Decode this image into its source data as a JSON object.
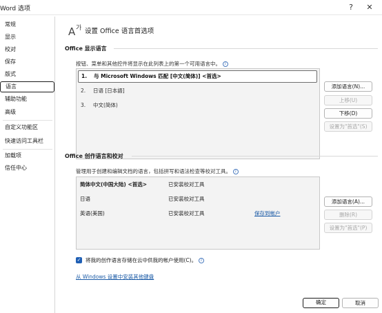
{
  "window": {
    "title": "Word 选项",
    "help_label": "?",
    "close_label": "✕"
  },
  "sidebar": {
    "items": [
      {
        "label": "常规"
      },
      {
        "label": "显示"
      },
      {
        "label": "校对"
      },
      {
        "label": "保存"
      },
      {
        "label": "版式"
      },
      {
        "label": "语言"
      },
      {
        "label": "辅助功能"
      },
      {
        "label": "高级"
      },
      {
        "label": "自定义功能区"
      },
      {
        "label": "快速访问工具栏"
      },
      {
        "label": "加载项"
      },
      {
        "label": "信任中心"
      }
    ],
    "active_index": 5
  },
  "header": {
    "title": "设置 Office 语言首选项",
    "icon": "language-icon"
  },
  "display_section": {
    "title": "Office 显示语言",
    "description": "按钮、菜单和其他控件将显示在此列表上的第一个可用语言中。",
    "items": [
      {
        "num": "1.",
        "label": "与 Microsoft Windows 匹配 [中文(简体)] <首选>"
      },
      {
        "num": "2.",
        "label": "日语 [日本語]"
      },
      {
        "num": "3.",
        "label": "中文(简体)"
      }
    ],
    "buttons": {
      "add": "添加语言(N)...",
      "move_up": "上移(U)",
      "move_down": "下移(D)",
      "set_preferred": "设置为\"首选\"(S)"
    }
  },
  "authoring_section": {
    "title": "Office 创作语言和校对",
    "description": "管理用于创建和编辑文档的语言，包括拼写和语法检查等校对工具。",
    "rows": [
      {
        "language": "简体中文(中国大陆) <首选>",
        "status": "已安装校对工具",
        "link": ""
      },
      {
        "language": "日语",
        "status": "已安装校对工具",
        "link": ""
      },
      {
        "language": "英语(美国)",
        "status": "已安装校对工具",
        "link": "保存到帐户"
      }
    ],
    "buttons": {
      "add": "添加语言(A)...",
      "remove": "删除(R)",
      "set_preferred": "设置为\"首选\"(P)"
    }
  },
  "cloud_option": {
    "checked": true,
    "label": "将我的创作语言存储在云中供我的帐户使用(C)。"
  },
  "keyboard_link": "从 Windows 设置中安装其他键盘",
  "footer": {
    "ok": "确定",
    "cancel": "取消"
  },
  "colors": {
    "accent": "#1f5fb4",
    "link": "#1a5aa6"
  }
}
